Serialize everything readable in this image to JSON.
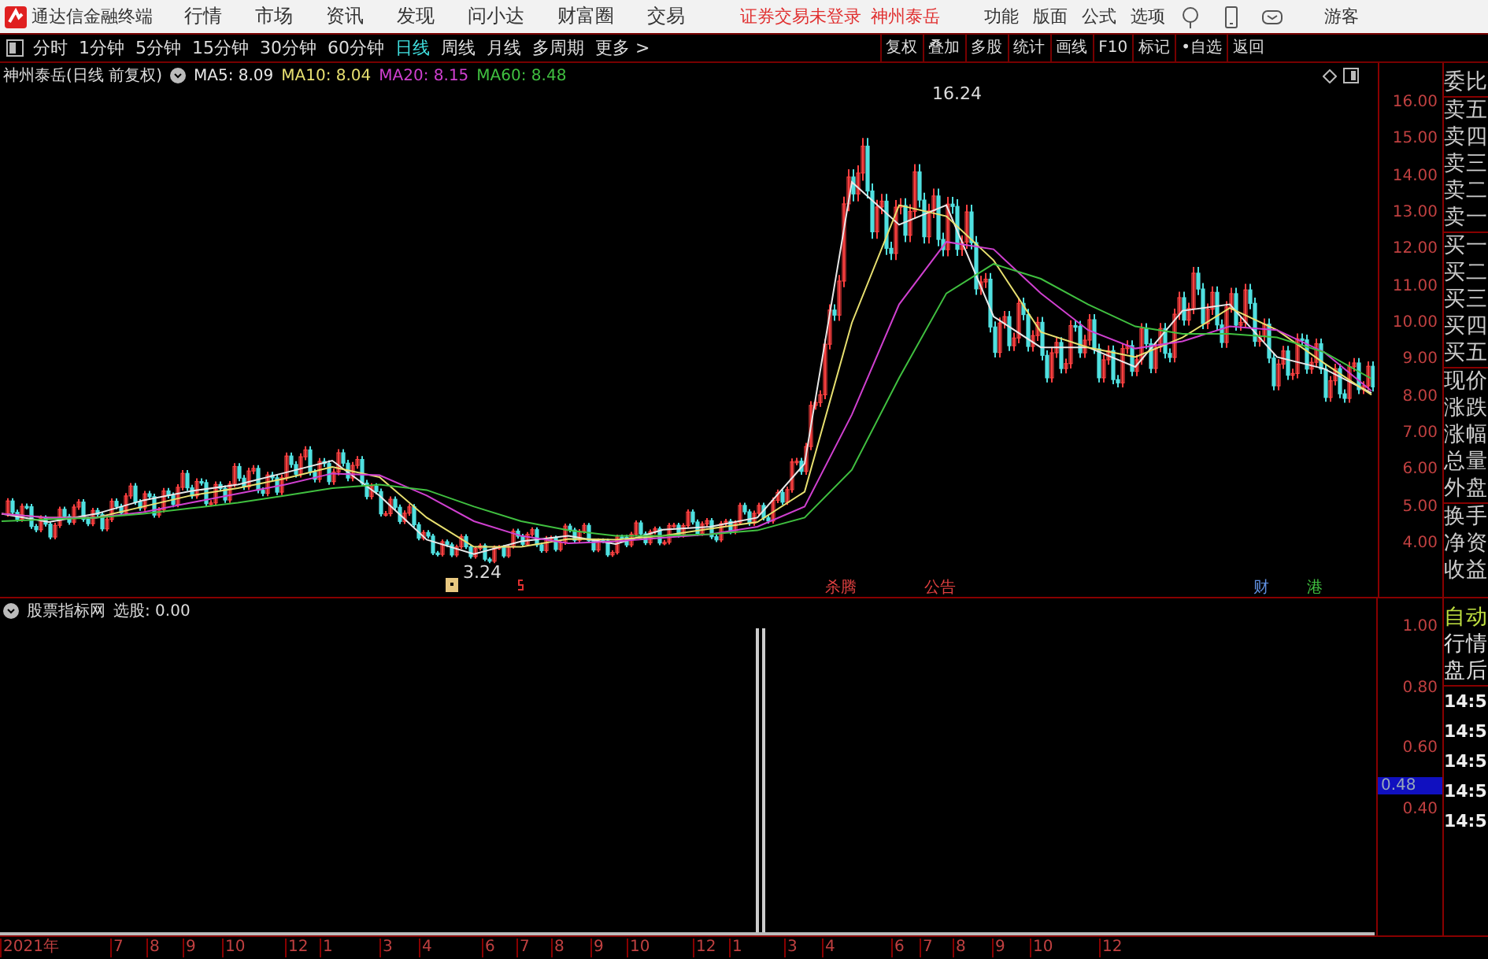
{
  "title_bar": {
    "app_name": "通达信金融终端",
    "menu": [
      "行情",
      "市场",
      "资讯",
      "发现",
      "问小达",
      "财富圈",
      "交易"
    ],
    "notice": "证券交易未登录",
    "stock": "神州泰岳",
    "tools": [
      "功能",
      "版面",
      "公式",
      "选项"
    ],
    "user": "游客"
  },
  "period_bar": {
    "periods": [
      {
        "label": "分时",
        "selected": false
      },
      {
        "label": "1分钟",
        "selected": false
      },
      {
        "label": "5分钟",
        "selected": false
      },
      {
        "label": "15分钟",
        "selected": false
      },
      {
        "label": "30分钟",
        "selected": false
      },
      {
        "label": "60分钟",
        "selected": false
      },
      {
        "label": "日线",
        "selected": true
      },
      {
        "label": "周线",
        "selected": false
      },
      {
        "label": "月线",
        "selected": false
      },
      {
        "label": "多周期",
        "selected": false
      }
    ],
    "more": "更多 >",
    "actions": [
      "复权",
      "叠加",
      "多股",
      "统计",
      "画线",
      "F10",
      "标记",
      "•自选",
      "返回"
    ]
  },
  "price_chart": {
    "title": "神州泰岳(日线 前复权)",
    "ma_readings": [
      ": 8.09",
      ": 8.04",
      ": 8.15",
      ": 8.48"
    ],
    "high_label": "16.24",
    "low_label": "3.24",
    "markers": [
      {
        "label": "杀腾",
        "color": "#e04040"
      },
      {
        "label": "公告",
        "color": "#e04040"
      },
      {
        "label": "财",
        "color": "#6090e0"
      },
      {
        "label": "港",
        "color": "#40c040"
      }
    ],
    "chart_data": {
      "type": "line",
      "ylim": [
        2.5,
        17.07
      ],
      "yticks": [
        {
          "value": 16,
          "label": "16.00"
        },
        {
          "value": 15,
          "label": "15.00"
        },
        {
          "value": 14,
          "label": "14.00"
        },
        {
          "value": 13,
          "label": "13.00"
        },
        {
          "value": 12,
          "label": "12.00"
        },
        {
          "value": 11,
          "label": "11.00"
        },
        {
          "value": 10,
          "label": "10.00"
        },
        {
          "value": 9,
          "label": "9.00"
        },
        {
          "value": 8,
          "label": "8.00"
        },
        {
          "value": 7,
          "label": "7.00"
        },
        {
          "value": 6,
          "label": "6.00"
        },
        {
          "value": 5,
          "label": "5.00"
        },
        {
          "value": 4,
          "label": "4.00"
        }
      ],
      "series": [
        {
          "name": "MA5",
          "color": "#e8e8e8",
          "values": [
            4.8,
            4.58,
            4.8,
            5.17,
            5.42,
            5.6,
            5.92,
            6.25,
            5.3,
            4.1,
            3.71,
            4.05,
            4.2,
            3.98,
            4.37,
            4.45,
            4.7,
            6.17,
            13.83,
            12.67,
            13.2,
            10.17,
            9.33,
            9.33,
            8.8,
            10.33,
            10.5,
            9.07,
            8.75,
            8.09
          ]
        },
        {
          "name": "MA10",
          "color": "#e8e070",
          "values": [
            4.8,
            4.7,
            4.7,
            5.0,
            5.3,
            5.5,
            5.76,
            6.08,
            5.8,
            4.7,
            3.9,
            3.9,
            4.12,
            4.1,
            4.2,
            4.4,
            4.58,
            5.4,
            10.0,
            13.2,
            12.9,
            11.7,
            9.75,
            9.33,
            9.07,
            9.6,
            10.4,
            9.8,
            8.9,
            8.04
          ]
        },
        {
          "name": "MA20",
          "color": "#d040d0",
          "values": [
            4.8,
            4.7,
            4.7,
            4.85,
            5.1,
            5.35,
            5.6,
            5.9,
            5.85,
            5.3,
            4.6,
            4.2,
            4.0,
            4.05,
            4.15,
            4.25,
            4.45,
            5.0,
            7.5,
            10.5,
            12.2,
            12.0,
            10.8,
            9.8,
            9.3,
            9.5,
            9.9,
            9.8,
            9.2,
            8.15
          ]
        },
        {
          "name": "MA60",
          "color": "#40c040",
          "values": [
            4.6,
            4.65,
            4.7,
            4.8,
            4.95,
            5.1,
            5.3,
            5.5,
            5.6,
            5.45,
            5.0,
            4.6,
            4.35,
            4.2,
            4.2,
            4.25,
            4.35,
            4.7,
            6.0,
            8.5,
            10.8,
            11.6,
            11.2,
            10.5,
            9.9,
            9.7,
            9.7,
            9.6,
            9.2,
            8.48
          ]
        }
      ]
    }
  },
  "indicator": {
    "title": "股票指标网",
    "reading": "选股: 0.00",
    "y_axis": [
      {
        "label": "1.00",
        "kind": "tick"
      },
      {
        "label": "0.80",
        "kind": "tick"
      },
      {
        "label": "0.60",
        "kind": "tick"
      },
      {
        "label": "0.48",
        "kind": "current"
      },
      {
        "label": "0.40",
        "kind": "tick"
      }
    ]
  },
  "quote_panel": {
    "groups": [
      [
        "委比"
      ],
      [
        "卖五",
        "卖四",
        "卖三",
        "卖二",
        "卖一"
      ],
      [
        "买一",
        "买二",
        "买三",
        "买四",
        "买五"
      ],
      [
        "现价",
        "涨跌",
        "涨幅",
        "总量",
        "外盘"
      ],
      [
        "换手",
        "净资",
        "收益"
      ]
    ]
  },
  "info_panel": {
    "tabs": [
      "自动",
      "行情",
      "盘后"
    ],
    "times": [
      "14:5",
      "14:5",
      "14:5",
      "14:5",
      "14:5"
    ]
  },
  "date_axis": [
    "2021年",
    "7",
    "8",
    "9",
    "10",
    "12",
    "1",
    "3",
    "4",
    "6",
    "7",
    "8",
    "9",
    "10",
    "12",
    "1",
    "3",
    "4",
    "6",
    "7",
    "8",
    "9",
    "10",
    "12"
  ]
}
